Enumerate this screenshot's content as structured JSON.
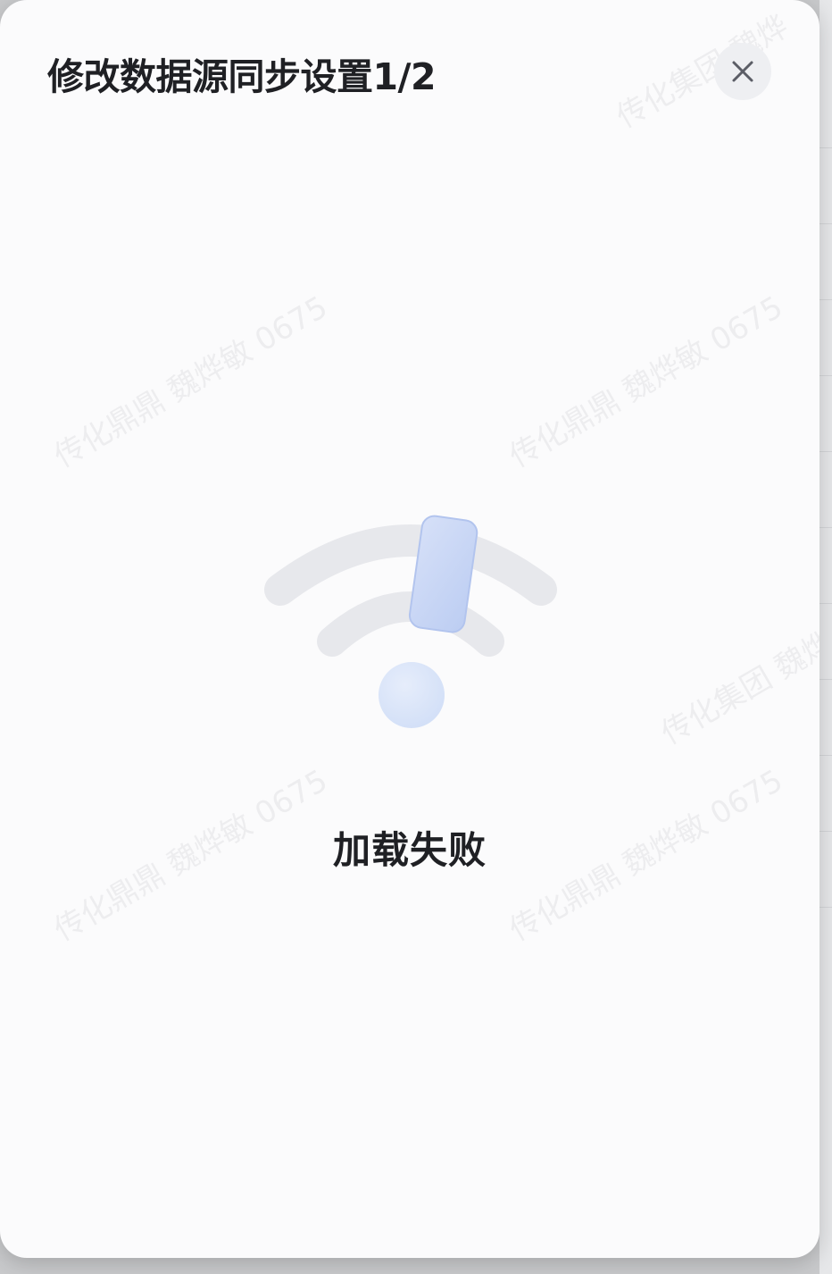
{
  "dialog": {
    "title": "修改数据源同步设置1/2",
    "close_icon": "close-icon"
  },
  "empty_state": {
    "illustration_icon": "wifi-error-icon",
    "message": "加载失败"
  },
  "watermark": {
    "text": "传化鼎鼎 魏烨敏 0675",
    "text_alt": "传化集团 魏烨"
  },
  "colors": {
    "modal_bg": "#fbfbfc",
    "title": "#1f2024",
    "close_bg": "#eeeff2",
    "close_icon": "#5b5d66",
    "wifi_arc": "#e7e8ec",
    "exclaim_blue": "#c9d6f5"
  }
}
